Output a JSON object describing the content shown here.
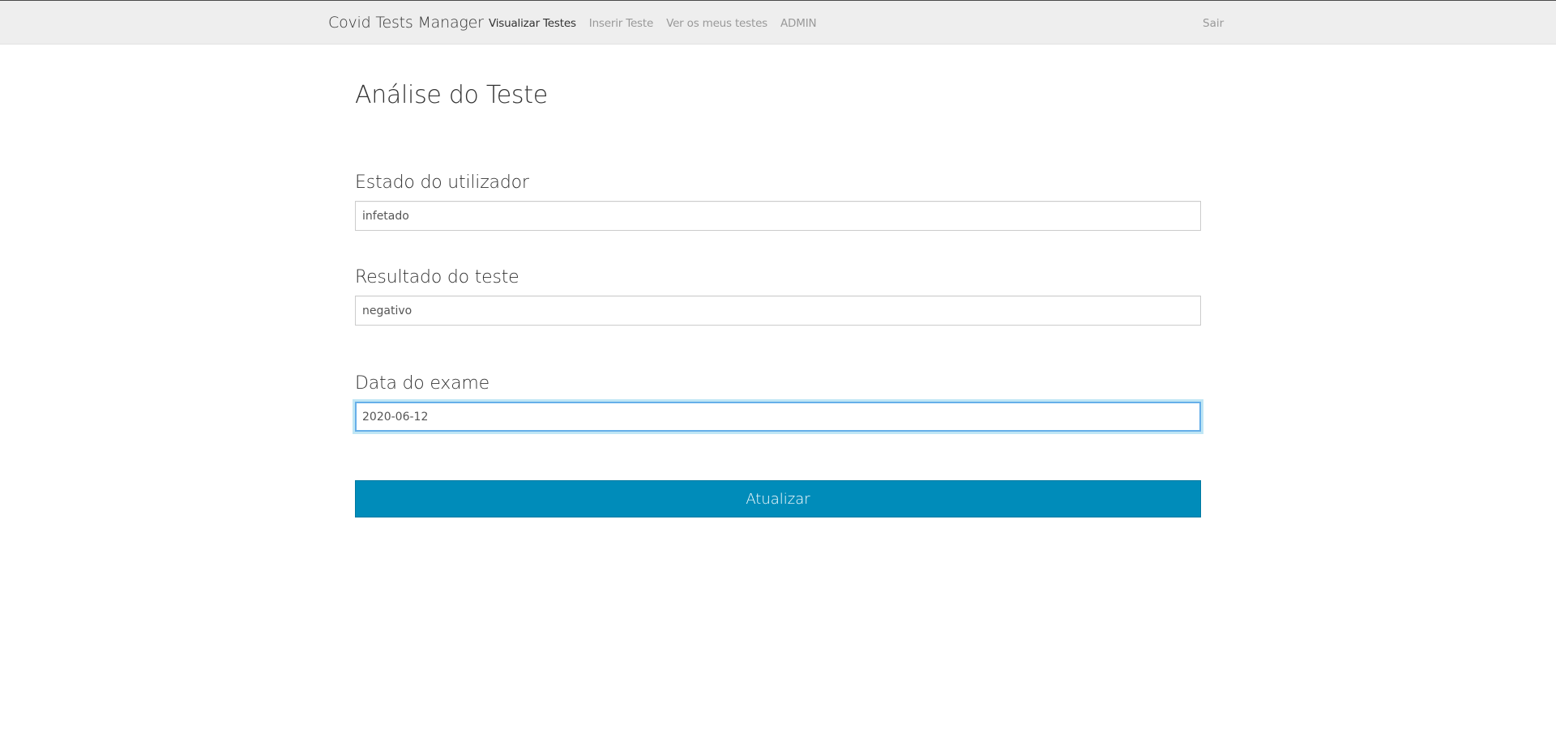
{
  "navbar": {
    "brand": "Covid Tests Manager",
    "links": [
      {
        "label": "Visualizar Testes"
      },
      {
        "label": "Inserir Teste"
      },
      {
        "label": "Ver os meus testes"
      },
      {
        "label": "ADMIN"
      }
    ],
    "logout_label": "Sair"
  },
  "form": {
    "title": "Análise do Teste",
    "user_state": {
      "label": "Estado do utilizador",
      "value": "infetado"
    },
    "test_result": {
      "label": "Resultado do teste",
      "value": "negativo"
    },
    "exam_date": {
      "label": "Data do exame",
      "value": "2020-06-12"
    },
    "submit_label": "Atualizar"
  },
  "colors": {
    "navbar_bg": "#eeeeee",
    "primary_button": "#008cba",
    "focus_ring": "#66afe9"
  }
}
